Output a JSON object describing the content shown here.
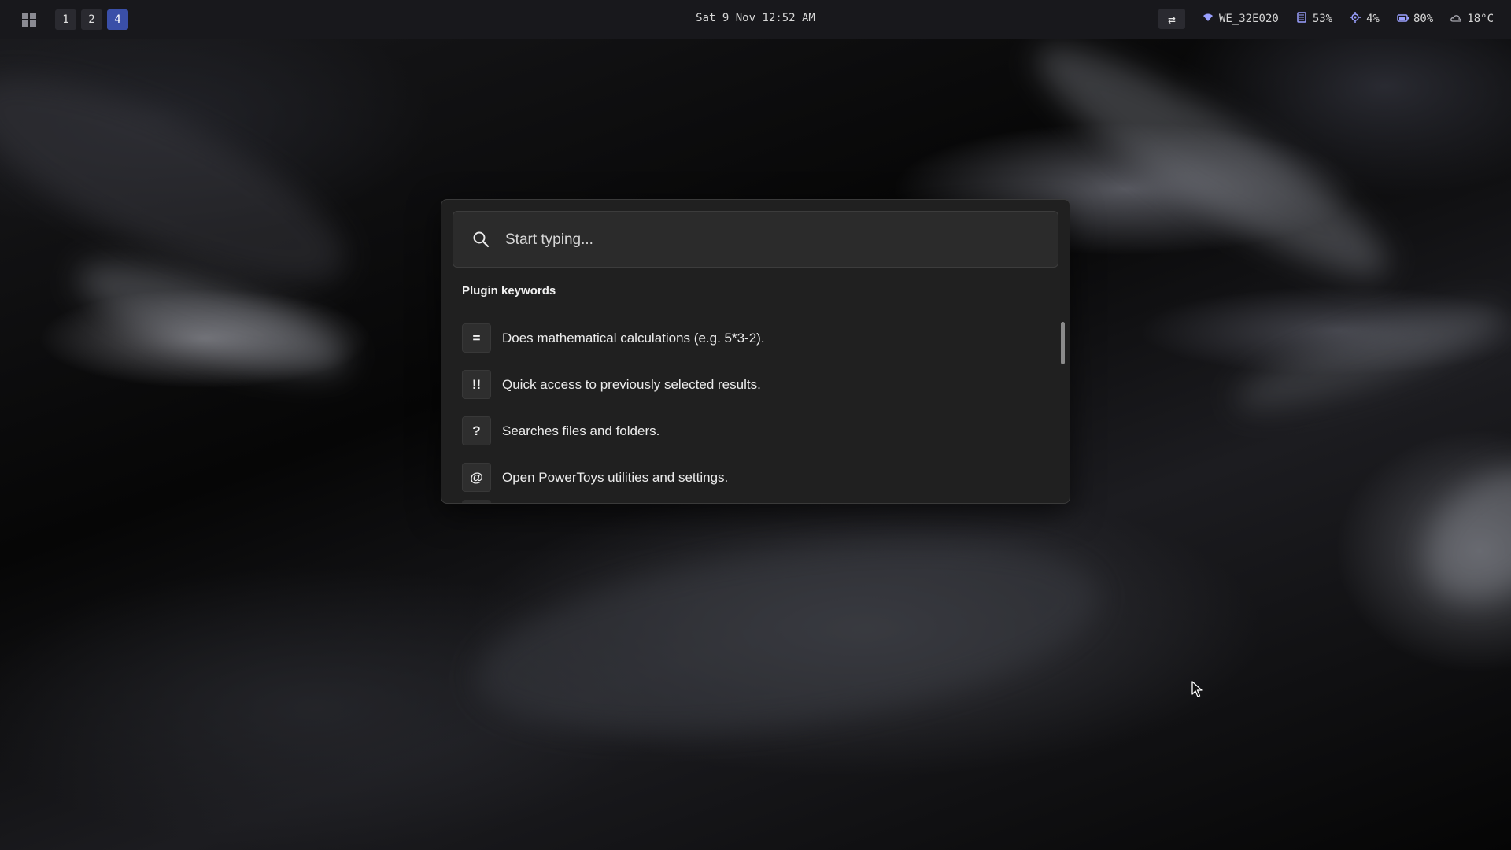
{
  "topbar": {
    "workspaces": [
      {
        "label": "1",
        "active": false
      },
      {
        "label": "2",
        "active": false
      },
      {
        "label": "4",
        "active": true
      }
    ],
    "clock": "Sat 9 Nov 12:52 AM",
    "tray": {
      "wifi_name": "WE_32E020",
      "memory": "53%",
      "cpu": "4%",
      "battery": "80%",
      "temperature": "18°C"
    },
    "accent_color": "#3a4fa8"
  },
  "launcher": {
    "search_placeholder": "Start typing...",
    "section_title": "Plugin keywords",
    "results": [
      {
        "keyword": "=",
        "description": "Does mathematical calculations (e.g. 5*3-2)."
      },
      {
        "keyword": "!!",
        "description": "Quick access to previously selected results."
      },
      {
        "keyword": "?",
        "description": "Searches files and folders."
      },
      {
        "keyword": "@",
        "description": "Open PowerToys utilities and settings."
      }
    ]
  },
  "icons": {
    "start": "windows-logo-icon",
    "search": "search-icon",
    "swap": "swap-arrows-icon",
    "wifi": "wifi-icon",
    "memory": "memory-icon",
    "cpu": "cpu-icon",
    "battery": "battery-icon",
    "weather": "cloud-icon",
    "cursor": "mouse-pointer-icon"
  }
}
